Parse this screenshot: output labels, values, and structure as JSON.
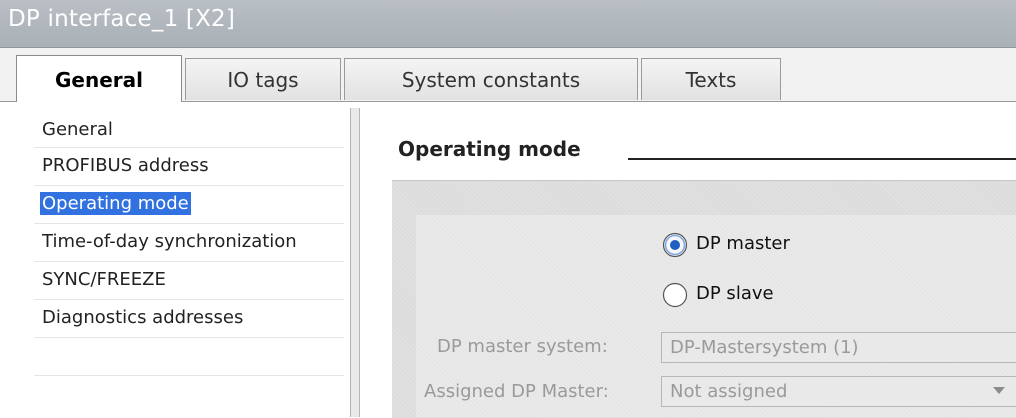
{
  "window": {
    "title": "DP interface_1 [X2]"
  },
  "tabs": [
    {
      "label": "General",
      "active": true
    },
    {
      "label": "IO tags"
    },
    {
      "label": "System constants"
    },
    {
      "label": "Texts"
    }
  ],
  "nav": {
    "items": [
      {
        "label": "General"
      },
      {
        "label": "PROFIBUS address"
      },
      {
        "label": "Operating mode",
        "selected": true
      },
      {
        "label": "Time-of-day synchronization"
      },
      {
        "label": "SYNC/FREEZE"
      },
      {
        "label": "Diagnostics addresses"
      }
    ]
  },
  "section": {
    "title": "Operating mode"
  },
  "mode": {
    "options": [
      {
        "label": "DP master",
        "checked": true
      },
      {
        "label": "DP slave",
        "checked": false
      }
    ]
  },
  "fields": {
    "master_system": {
      "label": "DP master system:",
      "value": "DP-Mastersystem (1)"
    },
    "assigned_master": {
      "label": "Assigned DP Master:",
      "value": "Not assigned"
    }
  },
  "colors": {
    "selection": "#3171e0",
    "titlebar": "#b0b6bc",
    "radio_accent": "#1f5fc4"
  }
}
